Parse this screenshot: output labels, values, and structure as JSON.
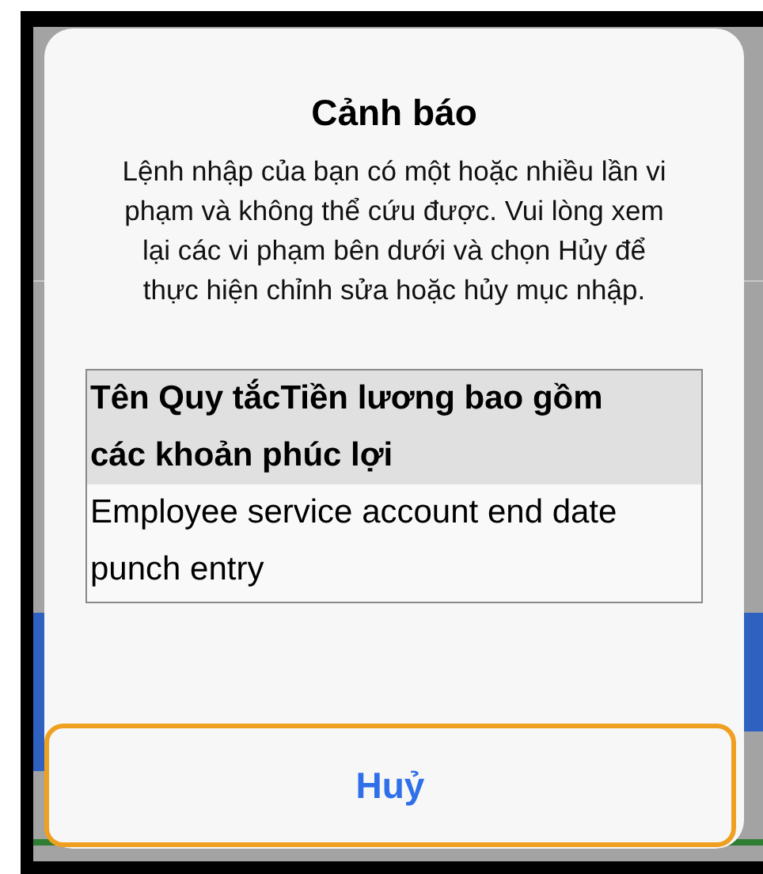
{
  "dialog": {
    "title": "Cảnh báo",
    "message": "Lệnh nhập của bạn có một hoặc nhiều lần vi phạm và không thể cứu được. Vui lòng xem lại các vi phạm bên dưới và chọn Hủy để thực hiện chỉnh sửa hoặc hủy mục nhập.",
    "table": {
      "header": "Tên Quy tắcTiền lương bao gồm các khoản phúc lợi",
      "rows": [
        "Employee service account end date punch entry"
      ]
    },
    "button": {
      "label": "Huỷ",
      "focused": true
    }
  }
}
